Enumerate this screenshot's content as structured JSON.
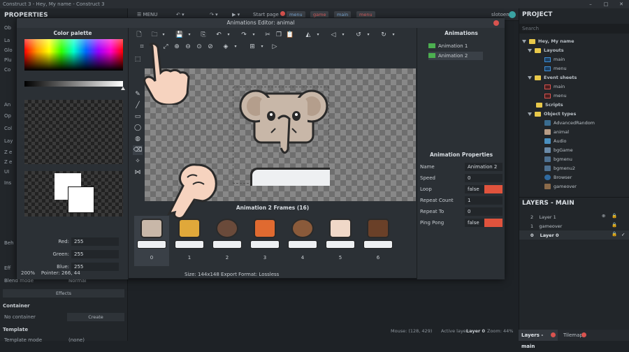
{
  "window": {
    "title": "Construct 3 - Hey, My name - Construct 3"
  },
  "toolbar": {
    "menu_label": "MENU",
    "start_page": "Start page",
    "tabs": [
      "menu",
      "game",
      "main",
      "menu"
    ],
    "user": "slotoen"
  },
  "left_panel": {
    "title": "PROPERTIES",
    "rows": [
      "Ob",
      "La",
      "Glo",
      "Plu",
      "Co",
      "An",
      "Op",
      "Col",
      "Lay",
      "Z e",
      "Z e",
      "UI",
      "Ins",
      "Beh",
      "Eff"
    ],
    "blend_mode_label": "Blend mode",
    "blend_mode_value": "Normal",
    "effects_button": "Effects",
    "container_section": "Container",
    "no_container": "No container",
    "create_button": "Create",
    "template_section": "Template",
    "template_mode_label": "Template mode",
    "template_mode_value": "(none)"
  },
  "editor": {
    "title": "Animations Editor: animal",
    "palette": {
      "title": "Color palette",
      "red_label": "Red:",
      "red": "255",
      "green_label": "Green:",
      "green": "255",
      "blue_label": "Blue:",
      "blue": "255"
    },
    "zoom": "200%",
    "pointer": "Pointer: 266, 44",
    "frames_title": "Animation 2 Frames (16)",
    "frame_numbers": [
      "0",
      "1",
      "2",
      "3",
      "4",
      "5",
      "6"
    ],
    "size_info": "Size: 144x148   Export Format: Lossless",
    "animations_title": "Animations",
    "animations": [
      "Animation 1",
      "Animation 2"
    ],
    "properties_title": "Animation Properties",
    "properties": [
      {
        "key": "Name",
        "value": "Animation 2"
      },
      {
        "key": "Speed",
        "value": "0"
      },
      {
        "key": "Loop",
        "value": "false"
      },
      {
        "key": "Repeat Count",
        "value": "1"
      },
      {
        "key": "Repeat To",
        "value": "0"
      },
      {
        "key": "Ping Pong",
        "value": "false"
      }
    ]
  },
  "project": {
    "title": "PROJECT",
    "search_placeholder": "Search",
    "root": "Hey, My name",
    "layouts_folder": "Layouts",
    "layouts": [
      "main",
      "menu"
    ],
    "events_folder": "Event sheets",
    "events": [
      "main",
      "menu"
    ],
    "scripts_folder": "Scripts",
    "objects_folder": "Object types",
    "objects": [
      "AdvancedRandom",
      "animal",
      "Audio",
      "bgGame",
      "bgmenu",
      "bgmenu2",
      "Browser",
      "gameover"
    ]
  },
  "layers": {
    "title": "LAYERS - MAIN",
    "items": [
      {
        "index": "2",
        "name": "Layer 1"
      },
      {
        "index": "1",
        "name": "gameover"
      },
      {
        "index": "0",
        "name": "Layer 0"
      }
    ]
  },
  "status": {
    "mouse": "Mouse: (128, 429)",
    "active_layer_label": "Active layer:",
    "active_layer": "Layer 0",
    "zoom": "Zoom: 44%"
  },
  "bottom_tabs": [
    "Layers - main",
    "Tilemap"
  ]
}
